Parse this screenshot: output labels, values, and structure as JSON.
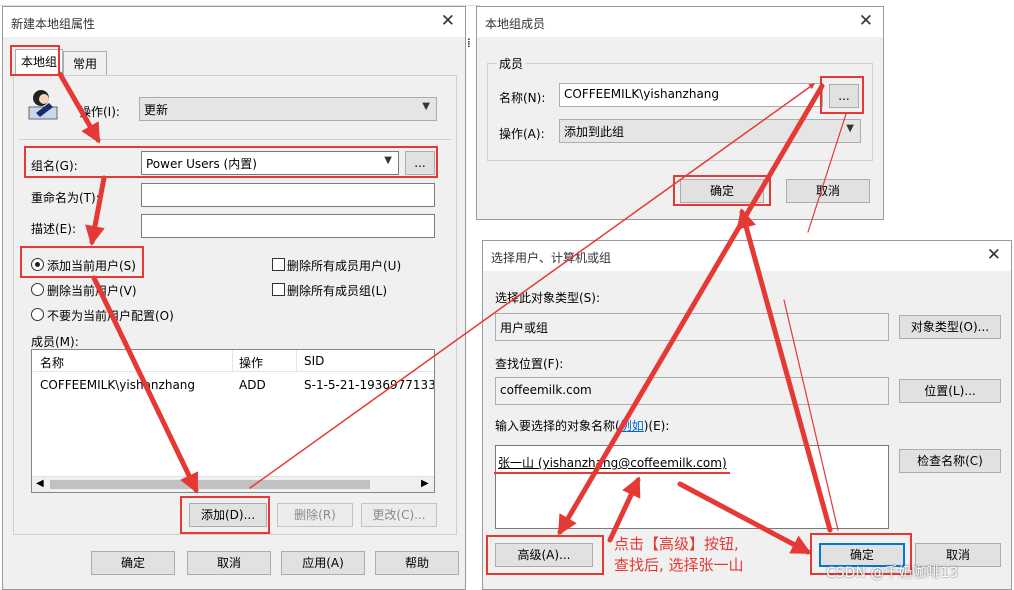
{
  "dialog_group_properties": {
    "title": "新建本地组属性",
    "close_glyph": "✕",
    "tabs": [
      "本地组",
      "常用"
    ],
    "action_label": "操作(I):",
    "action_value": "更新",
    "group_name_label": "组名(G):",
    "group_name_value": "Power Users (内置)",
    "browse_label": "...",
    "rename_label": "重命名为(T):",
    "description_label": "描述(E):",
    "radio_add_current": "添加当前用户(S)",
    "radio_remove_current": "删除当前用户(V)",
    "radio_no_config": "不要为当前用户配置(O)",
    "check_delete_users": "删除所有成员用户(U)",
    "check_delete_groups": "删除所有成员组(L)",
    "members_label": "成员(M):",
    "columns": [
      "名称",
      "操作",
      "SID"
    ],
    "rows": [
      {
        "name": "COFFEEMILK\\yishanzhang",
        "action": "ADD",
        "sid": "S-1-5-21-1936977133..."
      }
    ],
    "add_button": "添加(D)...",
    "remove_button": "删除(R)",
    "change_button": "更改(C)...",
    "ok_button": "确定",
    "cancel_button": "取消",
    "apply_button": "应用(A)",
    "help_button": "帮助"
  },
  "dialog_local_group_member": {
    "title": "本地组成员",
    "close_glyph": "✕",
    "group_label": "成员",
    "name_label": "名称(N):",
    "name_value": "COFFEEMILK\\yishanzhang",
    "browse_label": "...",
    "action_label": "操作(A):",
    "action_value": "添加到此组",
    "ok_button": "确定",
    "cancel_button": "取消"
  },
  "dialog_select_users": {
    "title": "选择用户、计算机或组",
    "close_glyph": "✕",
    "object_type_label": "选择此对象类型(S):",
    "object_type_value": "用户或组",
    "object_type_button": "对象类型(O)...",
    "location_label": "查找位置(F):",
    "location_value": "coffeemilk.com",
    "location_button": "位置(L)...",
    "enter_label_prefix": "输入要选择的对象名称(",
    "enter_label_link": "例如",
    "enter_label_suffix": ")(E):",
    "entered_value": "张一山 (yishanzhang@coffeemilk.com)",
    "check_names_button": "检查名称(C)",
    "advanced_button": "高级(A)...",
    "ok_button": "确定",
    "cancel_button": "取消"
  },
  "annotation": {
    "line1": "点击【高级】按钮,",
    "line2": "查找后, 选择张一山"
  },
  "watermark": "CSDN @千奶咖啡13",
  "colors": {
    "annotation_red": "#e53935",
    "focus_blue": "#0078d7",
    "link_blue": "#0066cc"
  }
}
